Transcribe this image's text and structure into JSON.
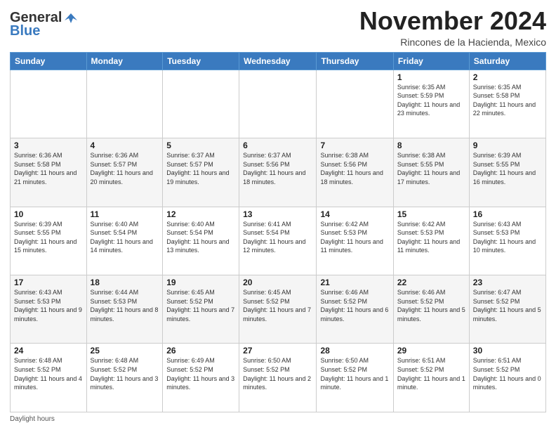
{
  "header": {
    "logo_general": "General",
    "logo_blue": "Blue",
    "month_title": "November 2024",
    "location": "Rincones de la Hacienda, Mexico"
  },
  "days_of_week": [
    "Sunday",
    "Monday",
    "Tuesday",
    "Wednesday",
    "Thursday",
    "Friday",
    "Saturday"
  ],
  "footer": {
    "label": "Daylight hours"
  },
  "weeks": [
    [
      {
        "day": "",
        "info": ""
      },
      {
        "day": "",
        "info": ""
      },
      {
        "day": "",
        "info": ""
      },
      {
        "day": "",
        "info": ""
      },
      {
        "day": "",
        "info": ""
      },
      {
        "day": "1",
        "info": "Sunrise: 6:35 AM\nSunset: 5:59 PM\nDaylight: 11 hours and 23 minutes."
      },
      {
        "day": "2",
        "info": "Sunrise: 6:35 AM\nSunset: 5:58 PM\nDaylight: 11 hours and 22 minutes."
      }
    ],
    [
      {
        "day": "3",
        "info": "Sunrise: 6:36 AM\nSunset: 5:58 PM\nDaylight: 11 hours and 21 minutes."
      },
      {
        "day": "4",
        "info": "Sunrise: 6:36 AM\nSunset: 5:57 PM\nDaylight: 11 hours and 20 minutes."
      },
      {
        "day": "5",
        "info": "Sunrise: 6:37 AM\nSunset: 5:57 PM\nDaylight: 11 hours and 19 minutes."
      },
      {
        "day": "6",
        "info": "Sunrise: 6:37 AM\nSunset: 5:56 PM\nDaylight: 11 hours and 18 minutes."
      },
      {
        "day": "7",
        "info": "Sunrise: 6:38 AM\nSunset: 5:56 PM\nDaylight: 11 hours and 18 minutes."
      },
      {
        "day": "8",
        "info": "Sunrise: 6:38 AM\nSunset: 5:55 PM\nDaylight: 11 hours and 17 minutes."
      },
      {
        "day": "9",
        "info": "Sunrise: 6:39 AM\nSunset: 5:55 PM\nDaylight: 11 hours and 16 minutes."
      }
    ],
    [
      {
        "day": "10",
        "info": "Sunrise: 6:39 AM\nSunset: 5:55 PM\nDaylight: 11 hours and 15 minutes."
      },
      {
        "day": "11",
        "info": "Sunrise: 6:40 AM\nSunset: 5:54 PM\nDaylight: 11 hours and 14 minutes."
      },
      {
        "day": "12",
        "info": "Sunrise: 6:40 AM\nSunset: 5:54 PM\nDaylight: 11 hours and 13 minutes."
      },
      {
        "day": "13",
        "info": "Sunrise: 6:41 AM\nSunset: 5:54 PM\nDaylight: 11 hours and 12 minutes."
      },
      {
        "day": "14",
        "info": "Sunrise: 6:42 AM\nSunset: 5:53 PM\nDaylight: 11 hours and 11 minutes."
      },
      {
        "day": "15",
        "info": "Sunrise: 6:42 AM\nSunset: 5:53 PM\nDaylight: 11 hours and 11 minutes."
      },
      {
        "day": "16",
        "info": "Sunrise: 6:43 AM\nSunset: 5:53 PM\nDaylight: 11 hours and 10 minutes."
      }
    ],
    [
      {
        "day": "17",
        "info": "Sunrise: 6:43 AM\nSunset: 5:53 PM\nDaylight: 11 hours and 9 minutes."
      },
      {
        "day": "18",
        "info": "Sunrise: 6:44 AM\nSunset: 5:53 PM\nDaylight: 11 hours and 8 minutes."
      },
      {
        "day": "19",
        "info": "Sunrise: 6:45 AM\nSunset: 5:52 PM\nDaylight: 11 hours and 7 minutes."
      },
      {
        "day": "20",
        "info": "Sunrise: 6:45 AM\nSunset: 5:52 PM\nDaylight: 11 hours and 7 minutes."
      },
      {
        "day": "21",
        "info": "Sunrise: 6:46 AM\nSunset: 5:52 PM\nDaylight: 11 hours and 6 minutes."
      },
      {
        "day": "22",
        "info": "Sunrise: 6:46 AM\nSunset: 5:52 PM\nDaylight: 11 hours and 5 minutes."
      },
      {
        "day": "23",
        "info": "Sunrise: 6:47 AM\nSunset: 5:52 PM\nDaylight: 11 hours and 5 minutes."
      }
    ],
    [
      {
        "day": "24",
        "info": "Sunrise: 6:48 AM\nSunset: 5:52 PM\nDaylight: 11 hours and 4 minutes."
      },
      {
        "day": "25",
        "info": "Sunrise: 6:48 AM\nSunset: 5:52 PM\nDaylight: 11 hours and 3 minutes."
      },
      {
        "day": "26",
        "info": "Sunrise: 6:49 AM\nSunset: 5:52 PM\nDaylight: 11 hours and 3 minutes."
      },
      {
        "day": "27",
        "info": "Sunrise: 6:50 AM\nSunset: 5:52 PM\nDaylight: 11 hours and 2 minutes."
      },
      {
        "day": "28",
        "info": "Sunrise: 6:50 AM\nSunset: 5:52 PM\nDaylight: 11 hours and 1 minute."
      },
      {
        "day": "29",
        "info": "Sunrise: 6:51 AM\nSunset: 5:52 PM\nDaylight: 11 hours and 1 minute."
      },
      {
        "day": "30",
        "info": "Sunrise: 6:51 AM\nSunset: 5:52 PM\nDaylight: 11 hours and 0 minutes."
      }
    ]
  ]
}
